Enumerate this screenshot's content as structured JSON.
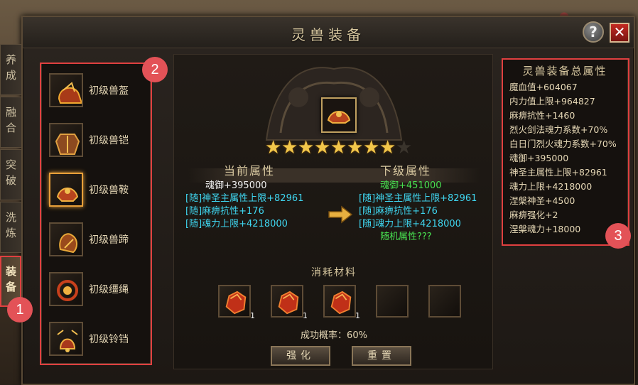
{
  "window": {
    "title": "灵兽装备",
    "help_label": "?",
    "close_label": "✕"
  },
  "tabs": [
    {
      "label": "养\n成",
      "active": false
    },
    {
      "label": "融\n合",
      "active": false
    },
    {
      "label": "突\n破",
      "active": false
    },
    {
      "label": "洗\n炼",
      "active": false
    },
    {
      "label": "装\n备",
      "active": true
    }
  ],
  "markers": [
    "1",
    "2",
    "3"
  ],
  "items": [
    {
      "name": "初级兽盔",
      "icon": "helmet-icon"
    },
    {
      "name": "初级兽铠",
      "icon": "armor-icon"
    },
    {
      "name": "初级兽鞍",
      "icon": "saddle-icon",
      "selected": true
    },
    {
      "name": "初级兽蹄",
      "icon": "hoof-icon"
    },
    {
      "name": "初级缰绳",
      "icon": "reins-icon"
    },
    {
      "name": "初级铃铛",
      "icon": "bell-icon"
    }
  ],
  "enhance": {
    "stars_filled": 8,
    "stars_total": 9,
    "current_header": "当前属性",
    "next_header": "下级属性",
    "current": [
      {
        "text": "魂御+395000",
        "color": "white"
      },
      {
        "text": "[随]神圣主属性上限+82961",
        "color": "cyan"
      },
      {
        "text": "[随]麻痹抗性+176",
        "color": "cyan"
      },
      {
        "text": "[随]魂力上限+4218000",
        "color": "cyan"
      }
    ],
    "next": [
      {
        "text": "魂御+451000",
        "color": "green"
      },
      {
        "text": "[随]神圣主属性上限+82961",
        "color": "cyan"
      },
      {
        "text": "[随]麻痹抗性+176",
        "color": "cyan"
      },
      {
        "text": "[随]魂力上限+4218000",
        "color": "cyan"
      },
      {
        "text": "随机属性???",
        "color": "green"
      }
    ],
    "consume_title": "消耗材料",
    "materials": [
      {
        "count": "1",
        "filled": true
      },
      {
        "count": "1",
        "filled": true
      },
      {
        "count": "1",
        "filled": true
      },
      {
        "count": "",
        "filled": false
      },
      {
        "count": "",
        "filled": false
      }
    ],
    "success_rate": "成功概率：60%",
    "enhance_button": "强化",
    "reset_button": "重置"
  },
  "summary": {
    "title": "灵兽装备总属性",
    "lines": [
      "魔血值+604067",
      "内力值上限+964827",
      "麻痹抗性+1460",
      "烈火剑法魂力系数+70%",
      "白日门烈火魂力系数+70%",
      "魂御+395000",
      "神圣主属性上限+82961",
      "魂力上限+4218000",
      "涅槃神圣+4500",
      "麻痹强化+2",
      "涅槃魂力+18000"
    ]
  },
  "colors": {
    "accent": "#e8a03a",
    "marker": "#e35257",
    "highlight_box": "#e04040",
    "stat_cyan": "#3fd6f0",
    "stat_green": "#48e050"
  }
}
